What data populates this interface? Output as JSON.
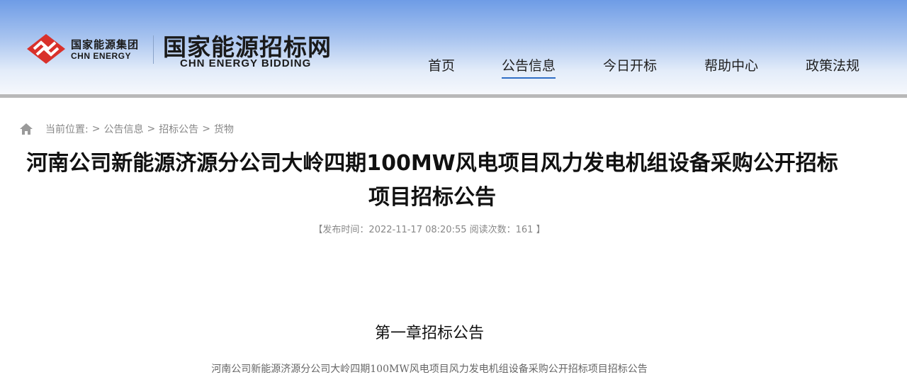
{
  "header": {
    "company_name_cn": "国家能源集团",
    "company_name_en": "CHN ENERGY",
    "site_title_cn": "国家能源招标网",
    "site_title_en": "CHN ENERGY BIDDING",
    "accent_color": "#2f6ec6",
    "logo_color": "#d9312b"
  },
  "nav": {
    "items": [
      {
        "label": "首页",
        "active": false
      },
      {
        "label": "公告信息",
        "active": true
      },
      {
        "label": "今日开标",
        "active": false
      },
      {
        "label": "帮助中心",
        "active": false
      },
      {
        "label": "政策法规",
        "active": false
      }
    ]
  },
  "breadcrumb": {
    "icon": "home-icon",
    "prefix": "当前位置:",
    "sep": ">",
    "items": [
      "公告信息",
      "招标公告",
      "货物"
    ]
  },
  "article": {
    "title": "河南公司新能源济源分公司大岭四期100MW风电项目风力发电机组设备采购公开招标项目招标公告",
    "meta": "【发布时间：2022-11-17 08:20:55 阅读次数：161 】",
    "chapter": "第一章招标公告",
    "paragraph": "河南公司新能源济源分公司大岭四期100MW风电项目风力发电机组设备采购公开招标项目招标公告"
  }
}
